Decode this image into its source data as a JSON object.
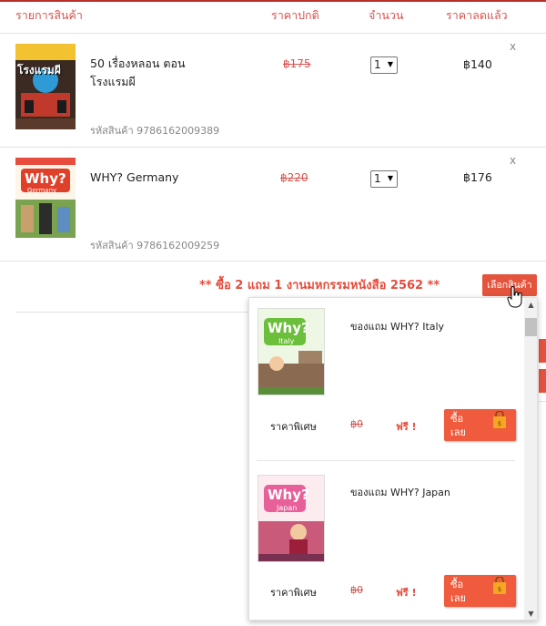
{
  "columns": {
    "item": "รายการสินค้า",
    "regular_price": "ราคาปกติ",
    "quantity": "จำนวน",
    "sale_price": "ราคาลดแล้ว"
  },
  "cart": [
    {
      "title_line1": "50 เรื่องหลอน ตอน",
      "title_line2": "โรงแรมผี",
      "sku": "รหัสสินค้า 9786162009389",
      "regular_price": "฿175",
      "quantity": "1",
      "sale_price": "฿140",
      "remove": "x",
      "cover_text": "โรงแรมผี"
    },
    {
      "title_line1": "WHY? Germany",
      "sku": "รหัสสินค้า 9786162009259",
      "regular_price": "฿220",
      "quantity": "1",
      "sale_price": "฿176",
      "remove": "x",
      "cover_text": "Why?",
      "cover_sub": "Germany"
    }
  ],
  "promo": {
    "text": "** ซื้อ 2 แถม 1 งานมหกรรมหนังสือ 2562 **",
    "pick_button": "เลือกสินค้า"
  },
  "gifts": [
    {
      "name": "ของแถม WHY? Italy",
      "label": "ราคาพิเศษ",
      "old_price": "฿0",
      "free": "ฟรี !",
      "buy": "ซื้อ เลย",
      "cover_text": "Why?",
      "cover_sub": "Italy"
    },
    {
      "name": "ของแถม WHY? Japan",
      "label": "ราคาพิเศษ",
      "old_price": "฿0",
      "free": "ฟรี !",
      "buy": "ซื้อ เลย",
      "cover_text": "Why?",
      "cover_sub": "Japan"
    }
  ],
  "icons": {
    "remove": "close-icon",
    "dropdown": "chevron-down-icon",
    "bag": "shopping-bag-icon",
    "cursor": "hand-pointer-icon"
  },
  "colors": {
    "accent": "#e74c3c",
    "button": "#e4543d"
  }
}
